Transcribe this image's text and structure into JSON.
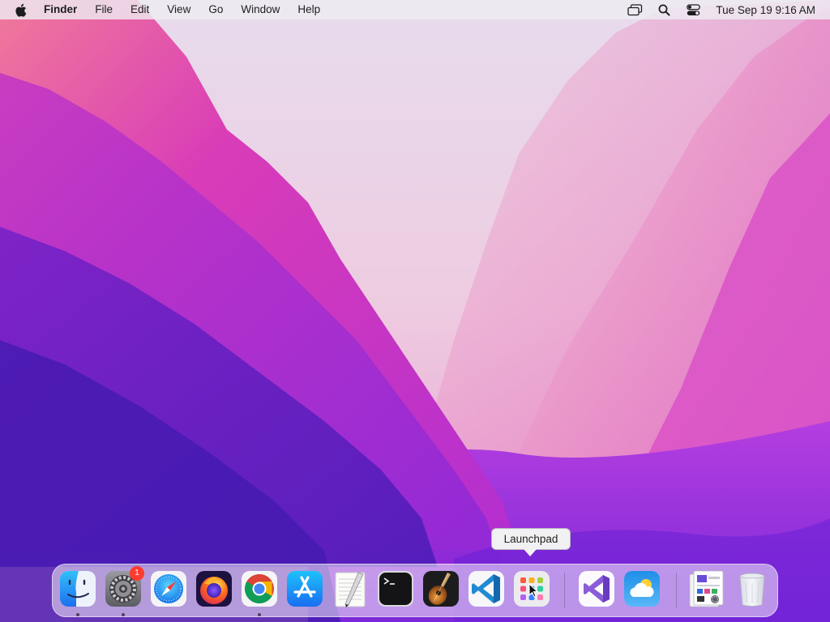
{
  "menubar": {
    "app_name": "Finder",
    "menus": [
      "File",
      "Edit",
      "View",
      "Go",
      "Window",
      "Help"
    ],
    "clock": "Tue Sep 19  9:16 AM"
  },
  "tooltip": {
    "text": "Launchpad"
  },
  "dock": {
    "apps": [
      {
        "name": "Finder",
        "icon": "finder-icon",
        "running": true
      },
      {
        "name": "System Settings",
        "icon": "gear-icon",
        "running": true,
        "badge": "1"
      },
      {
        "name": "Safari",
        "icon": "safari-compass-icon",
        "running": false
      },
      {
        "name": "Firefox",
        "icon": "firefox-icon",
        "running": false
      },
      {
        "name": "Google Chrome",
        "icon": "chrome-icon",
        "running": true
      },
      {
        "name": "App Store",
        "icon": "app-store-icon",
        "running": false
      },
      {
        "name": "TextEdit",
        "icon": "textedit-pen-icon",
        "running": false
      },
      {
        "name": "Terminal",
        "icon": "terminal-icon",
        "running": false
      },
      {
        "name": "GarageBand",
        "icon": "guitar-icon",
        "running": false
      },
      {
        "name": "Visual Studio Code",
        "icon": "vscode-icon",
        "running": false
      },
      {
        "name": "Launchpad",
        "icon": "launchpad-grid-icon",
        "running": false
      }
    ],
    "recent": [
      {
        "name": "Visual Studio",
        "icon": "visual-studio-icon"
      },
      {
        "name": "Weather",
        "icon": "weather-cloud-icon"
      }
    ],
    "stack": {
      "name": "Downloads",
      "icon": "downloads-stack-icon"
    },
    "trash": {
      "name": "Trash",
      "icon": "trash-icon"
    }
  },
  "colors": {
    "wallpaper_dark": "#4b1fb5",
    "wallpaper_magenta": "#c13ad0",
    "wallpaper_light": "#e8e0f4",
    "badge": "#ff3b30"
  }
}
